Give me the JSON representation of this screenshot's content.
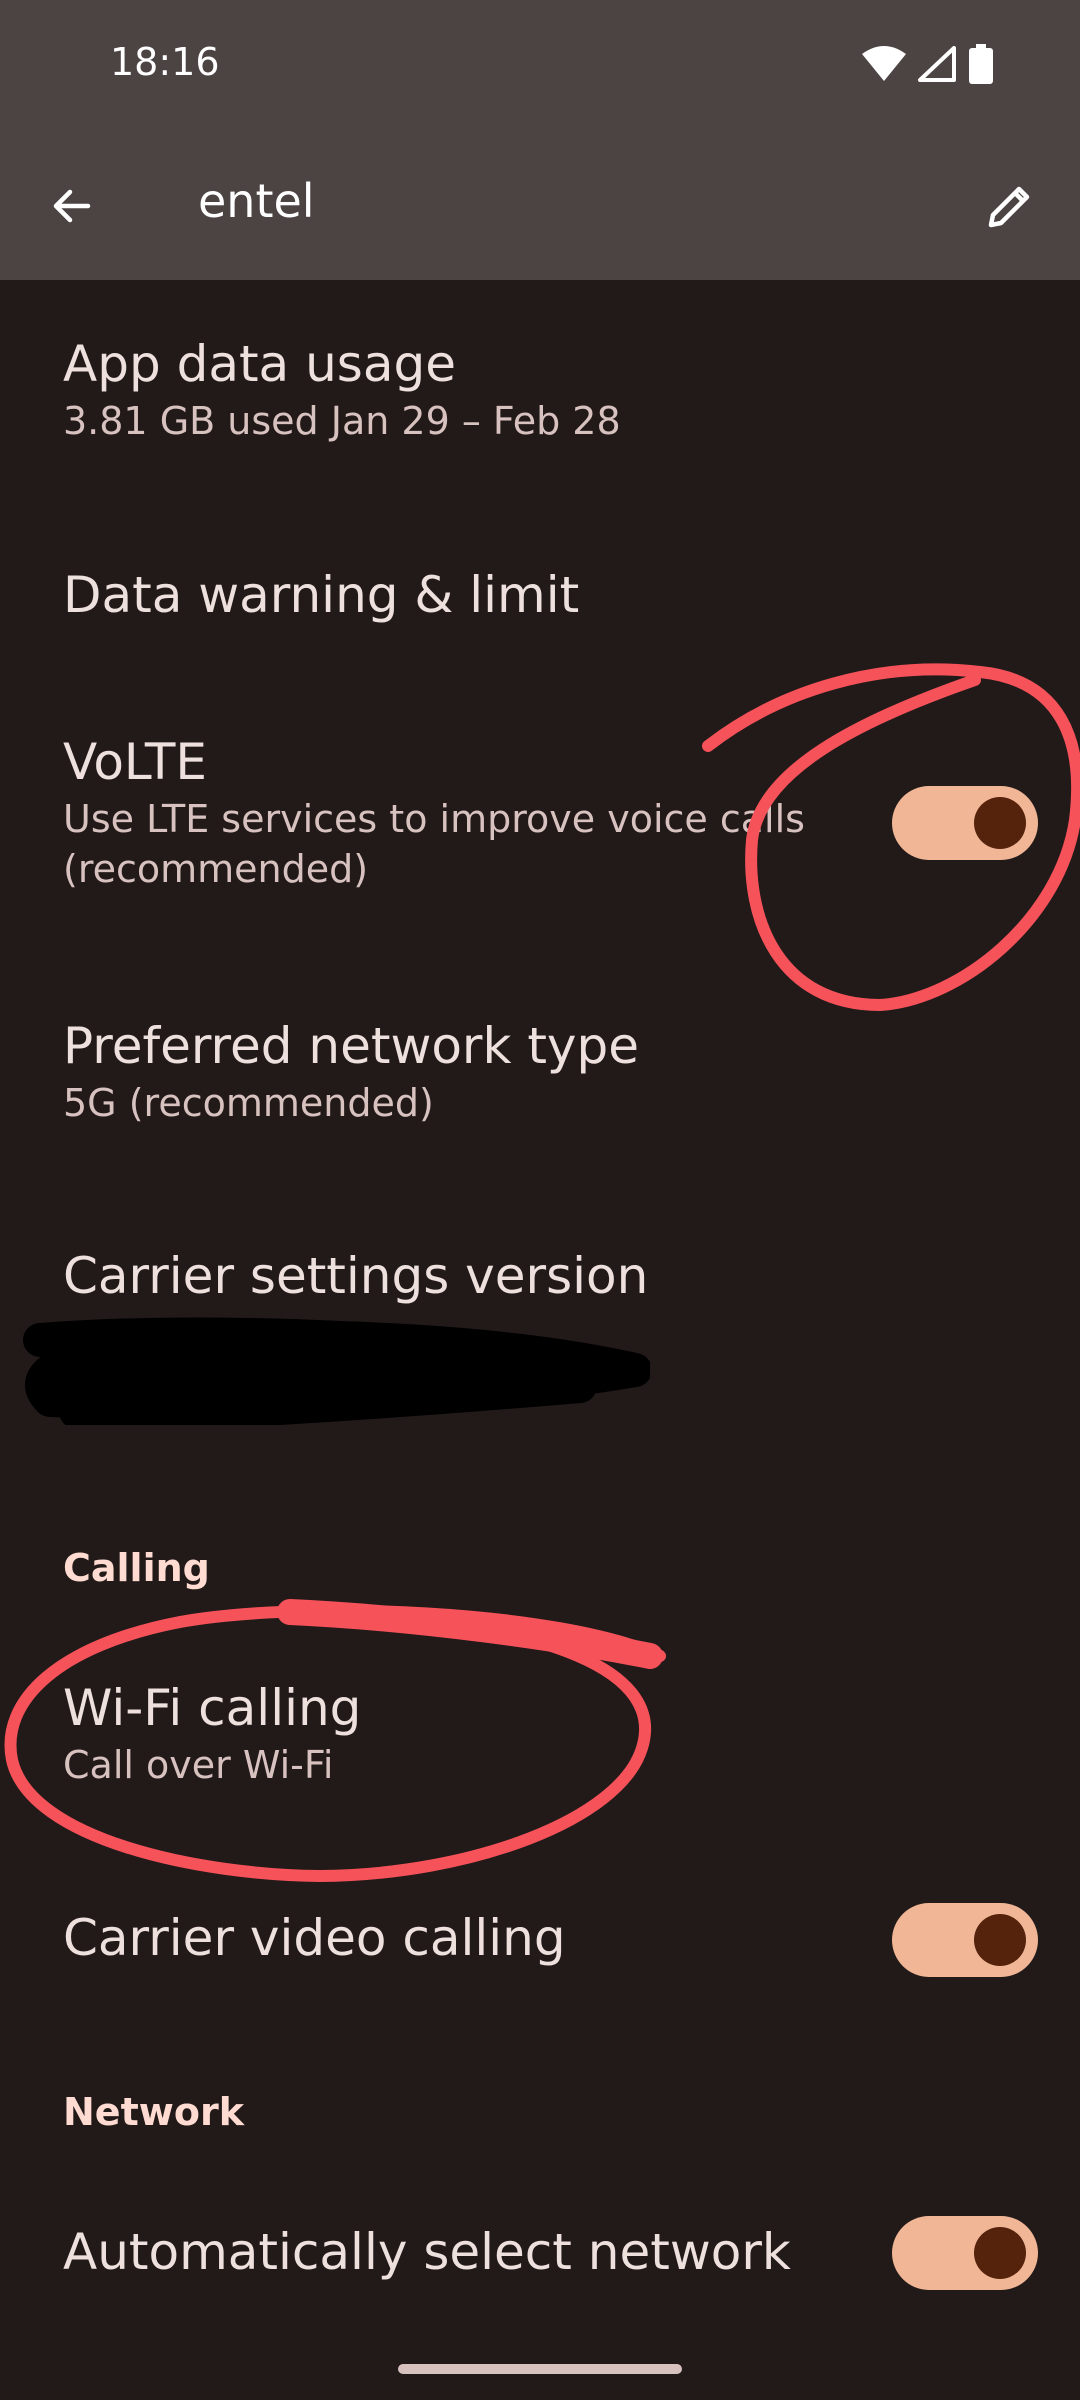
{
  "status_bar": {
    "time": "18:16",
    "icons": [
      "wifi-icon",
      "cell-signal-icon",
      "battery-icon"
    ]
  },
  "app_bar": {
    "title": "entel",
    "back_icon": "arrow-back-icon",
    "edit_icon": "pencil-icon"
  },
  "items": {
    "app_data_usage": {
      "title": "App data usage",
      "subtitle": "3.81 GB used Jan 29 – Feb 28"
    },
    "data_warning": {
      "title": "Data warning & limit"
    },
    "volte": {
      "title": "VoLTE",
      "subtitle_line1": "Use LTE services to improve voice calls",
      "subtitle_line2": "(recommended)",
      "enabled": true
    },
    "preferred_network": {
      "title": "Preferred network type",
      "subtitle": "5G (recommended)"
    },
    "carrier_settings": {
      "title": "Carrier settings version"
    },
    "wifi_calling": {
      "title": "Wi-Fi calling",
      "subtitle": "Call over Wi-Fi"
    },
    "carrier_video": {
      "title": "Carrier video calling",
      "enabled": true
    },
    "auto_select_network": {
      "title": "Automatically select network",
      "enabled": true
    }
  },
  "sections": {
    "calling": "Calling",
    "network": "Network"
  },
  "colors": {
    "background": "#221a19",
    "app_bar": "#4c4343",
    "toggle_track": "#f1b696",
    "toggle_thumb": "#55220b",
    "section_header": "#ffdbd1",
    "annotation": "#f6525a"
  }
}
